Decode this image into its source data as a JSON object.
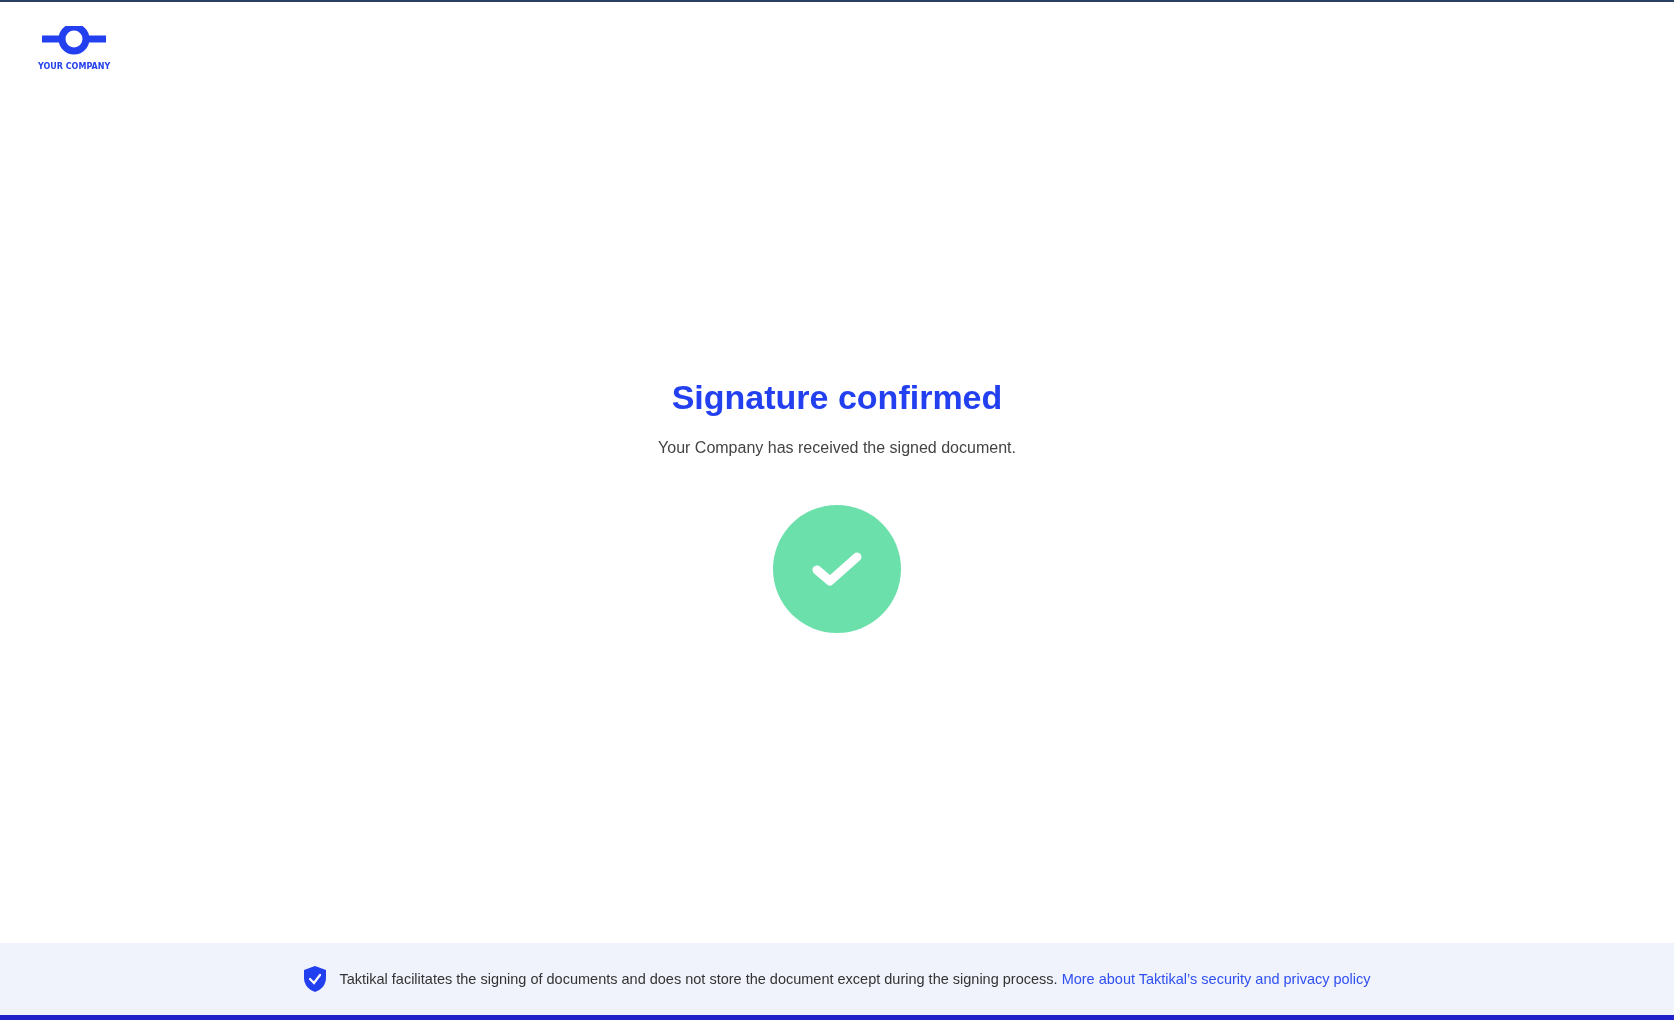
{
  "logo": {
    "label": "YOUR COMPANY"
  },
  "title": "Signature confirmed",
  "message": "Your Company has received the signed document.",
  "footer": {
    "text": "Taktikal facilitates the signing of documents and does not store the document except during the signing process.",
    "link": "More about Taktikal’s security and privacy policy"
  }
}
